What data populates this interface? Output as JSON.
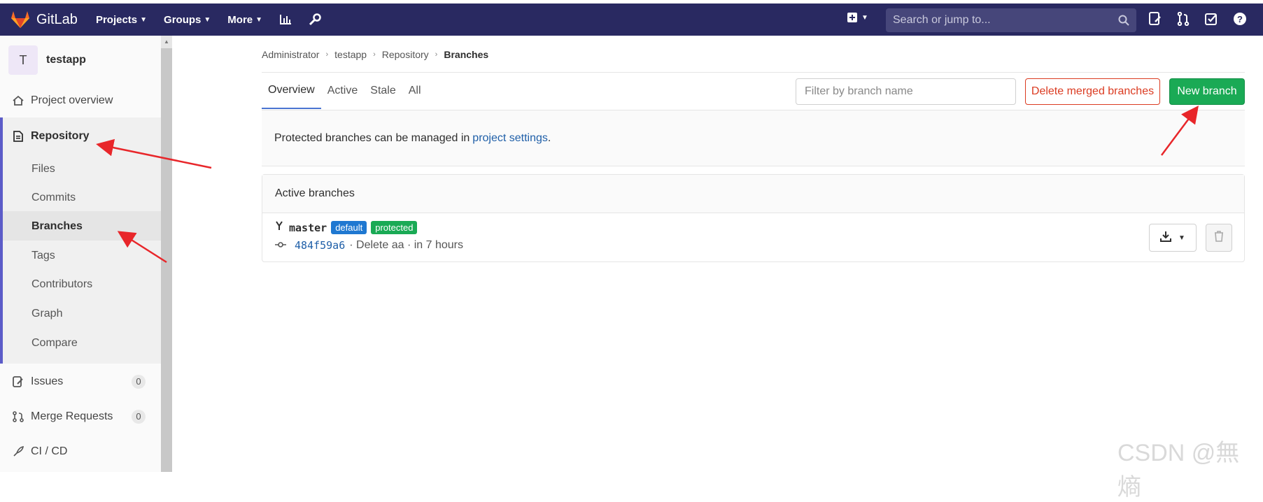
{
  "topbar": {
    "app_name": "GitLab",
    "nav": [
      "Projects",
      "Groups",
      "More"
    ],
    "search_placeholder": "Search or jump to...",
    "bg_color": "#292961"
  },
  "sidebar": {
    "project_initial": "T",
    "project_name": "testapp",
    "items": [
      {
        "label": "Project overview",
        "icon": "home-icon"
      },
      {
        "label": "Repository",
        "icon": "document-icon"
      },
      {
        "label": "Issues",
        "icon": "issues-icon",
        "count": "0"
      },
      {
        "label": "Merge Requests",
        "icon": "merge-request-icon",
        "count": "0"
      },
      {
        "label": "CI / CD",
        "icon": "rocket-icon"
      }
    ],
    "repo_subitems": [
      "Files",
      "Commits",
      "Branches",
      "Tags",
      "Contributors",
      "Graph",
      "Compare"
    ],
    "accent_color": "#5c5cc8"
  },
  "breadcrumb": [
    "Administrator",
    "testapp",
    "Repository",
    "Branches"
  ],
  "tabs": [
    "Overview",
    "Active",
    "Stale",
    "All"
  ],
  "filter_placeholder": "Filter by branch name",
  "buttons": {
    "delete_merged": "Delete merged branches",
    "new_branch": "New branch"
  },
  "notice": {
    "text": "Protected branches can be managed in",
    "link": "project settings",
    "end": "."
  },
  "active_branches": {
    "title": "Active branches",
    "branch": {
      "name": "master",
      "badges": [
        "default",
        "protected"
      ],
      "sha": "484f59a6",
      "message": "· Delete aa · in 7 hours"
    }
  },
  "watermark": "CSDN @無熵",
  "colors": {
    "danger": "#db3b21",
    "success": "#1aaa55",
    "link": "#1f5fa8",
    "annotation_red": "#e8262a"
  }
}
